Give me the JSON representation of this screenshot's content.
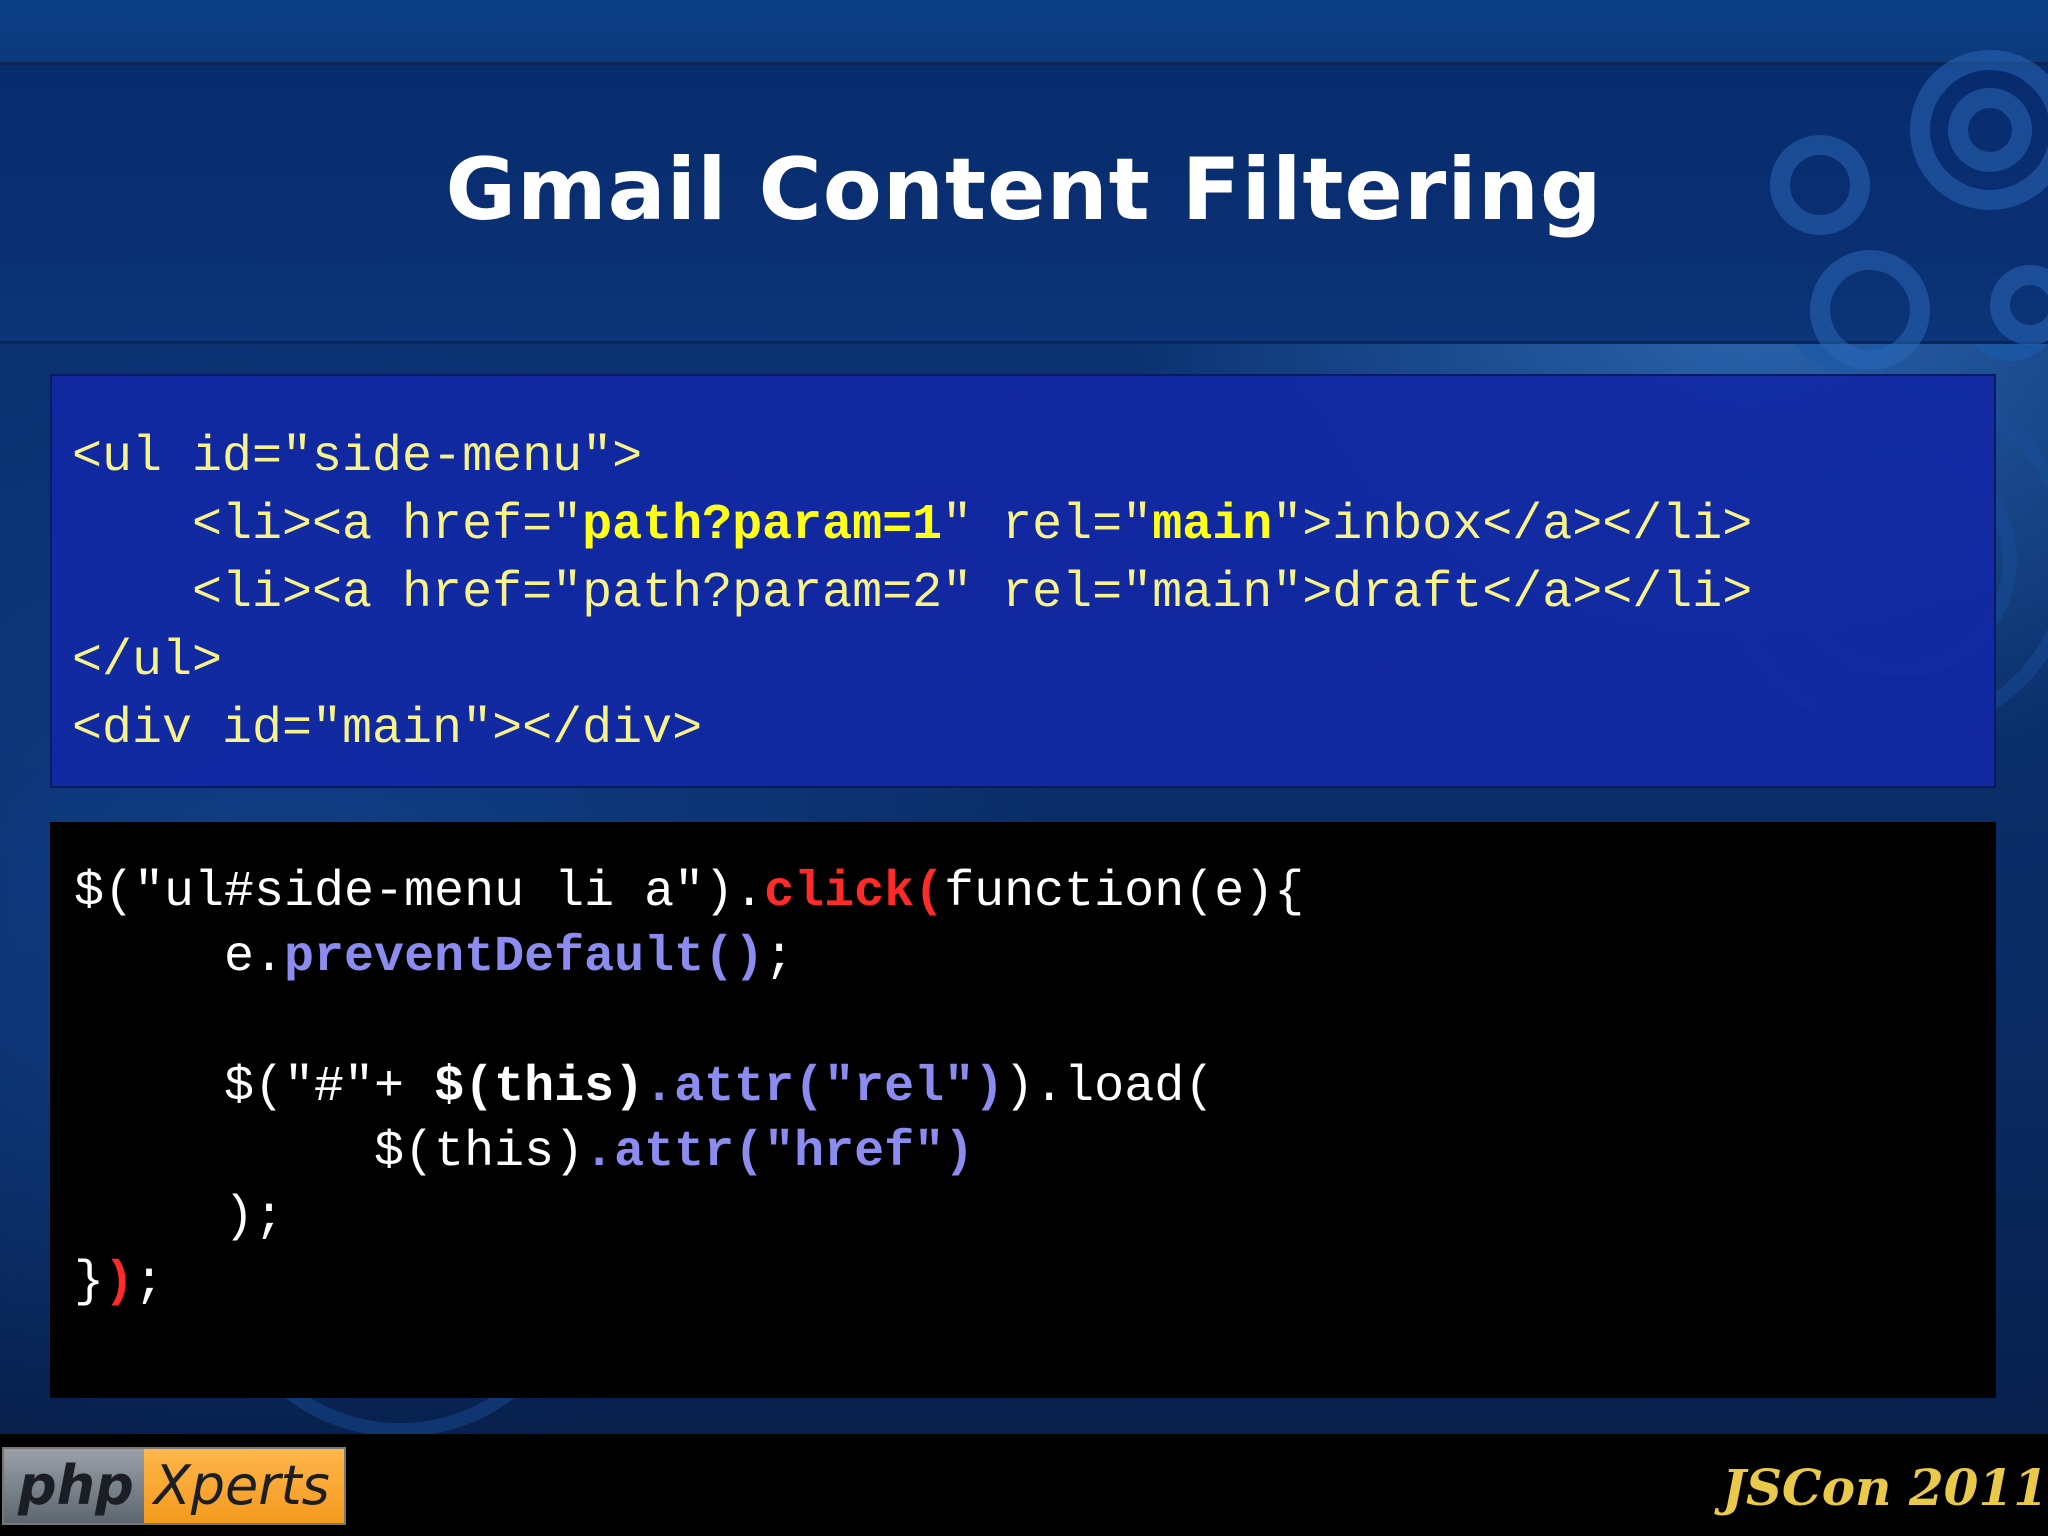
{
  "slide": {
    "title": "Gmail Content Filtering"
  },
  "html_code": {
    "line1": "<ul id=\"side-menu\">",
    "line2": {
      "a": "    <li><a href=\"",
      "b": "path?param=1",
      "c": "\" rel=\"",
      "d": "main",
      "e": "\">inbox</a></li>"
    },
    "line3": "    <li><a href=\"path?param=2\" rel=\"main\">draft</a></li>",
    "line4": "</ul>",
    "line5": "<div id=\"main\"></div>"
  },
  "js_code": {
    "line1": {
      "a": "$(\"ul#side-menu li a\").",
      "b": "click(",
      "c": "function(e){"
    },
    "line2": {
      "a": "     e.",
      "b": "preventDefault()",
      "c": ";"
    },
    "line4": {
      "a": "     $(\"#\"+ ",
      "b": "$(this)",
      "c": ".attr(\"rel\")",
      "d": ").load("
    },
    "line5": {
      "a": "          $(this)",
      "b": ".attr(\"href\")"
    },
    "line6": "     );",
    "line7": {
      "a": "}",
      "b": ")",
      "c": ";"
    }
  },
  "footer": {
    "logo_left": "php",
    "logo_right": "Xperts",
    "conference": "JSCon 2011"
  },
  "colors": {
    "title_band": "#072c6e",
    "html_box": "#1228a5",
    "highlight_yellow": "#ffff1a",
    "code_yellow": "#f7f28a",
    "keyword_red": "#ff2b2b",
    "method_blue": "#8b8bf0",
    "logo_orange": "#f39a1e",
    "conference_gold": "#e8c94a"
  }
}
